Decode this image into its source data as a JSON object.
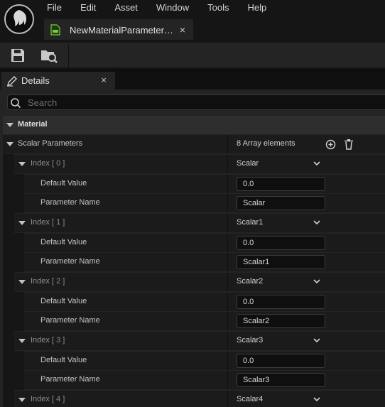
{
  "menu": [
    "File",
    "Edit",
    "Asset",
    "Window",
    "Tools",
    "Help"
  ],
  "asset_tab": {
    "label": "NewMaterialParameter…",
    "close": "×"
  },
  "details_tab": {
    "label": "Details",
    "close": "×"
  },
  "search": {
    "placeholder": "Search"
  },
  "category": {
    "label": "Material"
  },
  "scalar_parameters": {
    "label": "Scalar Parameters",
    "value": "8 Array elements"
  },
  "fields": {
    "default_value": "Default Value",
    "parameter_name": "Parameter Name"
  },
  "elements": [
    {
      "index": "Index [ 0 ]",
      "header": "Scalar",
      "default_value": "0.0",
      "parameter_name": "Scalar"
    },
    {
      "index": "Index [ 1 ]",
      "header": "Scalar1",
      "default_value": "0.0",
      "parameter_name": "Scalar1"
    },
    {
      "index": "Index [ 2 ]",
      "header": "Scalar2",
      "default_value": "0.0",
      "parameter_name": "Scalar2"
    },
    {
      "index": "Index [ 3 ]",
      "header": "Scalar3",
      "default_value": "0.0",
      "parameter_name": "Scalar3"
    },
    {
      "index": "Index [ 4 ]",
      "header": "Scalar4"
    }
  ],
  "colors": {
    "accent": "#7ac943",
    "panel": "#242424",
    "row": "#1b1b1b",
    "input": "#0f0f0f"
  }
}
